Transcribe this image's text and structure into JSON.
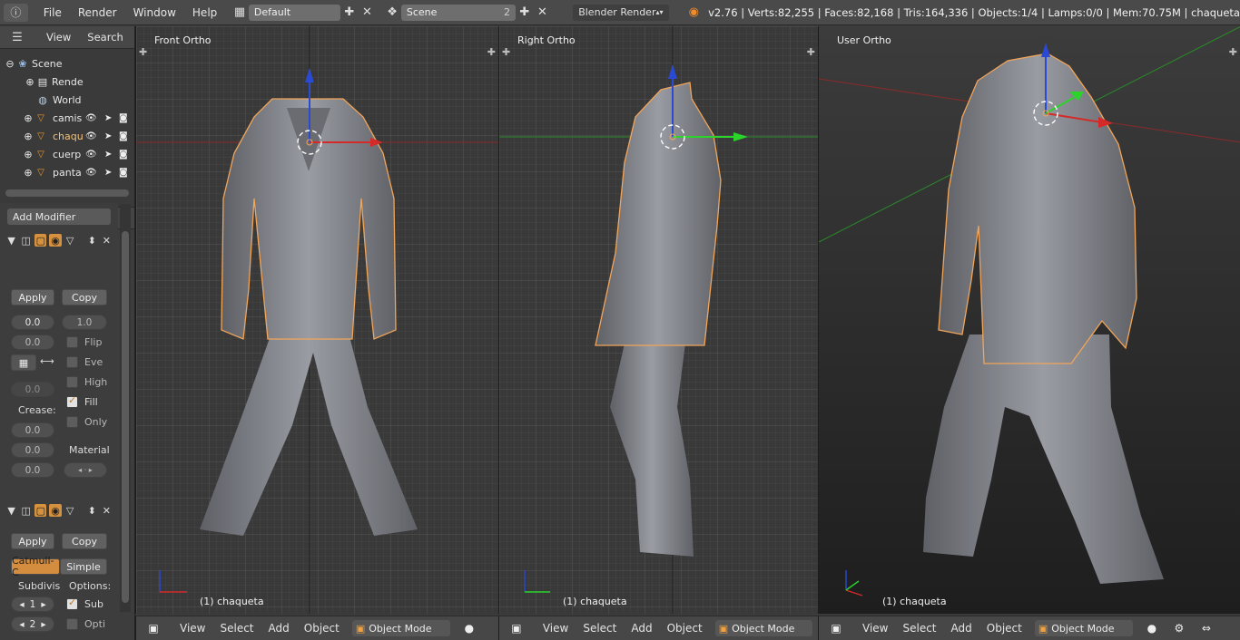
{
  "topbar": {
    "menus": [
      "File",
      "Render",
      "Window",
      "Help"
    ],
    "layout_name": "Default",
    "scene_name": "Scene",
    "scene_users": "2",
    "renderer": "Blender Render",
    "stats": "v2.76 | Verts:82,255 | Faces:82,168 | Tris:164,336 | Objects:1/4 | Lamps:0/0 | Mem:70.75M | chaqueta"
  },
  "outliner": {
    "header_items": [
      "View",
      "Search"
    ],
    "rows": [
      "Scene",
      "Rende",
      "World",
      "camis",
      "chaqu",
      "cuerp",
      "panta"
    ]
  },
  "properties": {
    "add_modifier": "Add Modifier",
    "mirror": {
      "apply": "Apply",
      "copy": "Copy",
      "val_a": "0.0",
      "val_b": "1.0",
      "val_c": "0.0",
      "val_d": "0.0",
      "flip": "Flip",
      "even": "Eve",
      "high": "High",
      "fill": "Fill",
      "only": "Only",
      "crease": "Crease:",
      "crease_1": "0.0",
      "crease_2": "0.0",
      "crease_3": "0.0",
      "material": "Material"
    },
    "subsurf": {
      "apply": "Apply",
      "copy": "Copy",
      "catmull": "Catmull-C",
      "simple": "Simple",
      "subdivis": "Subdivis",
      "options": "Options:",
      "level_1": "1",
      "level_2": "2",
      "sub": "Sub",
      "opti": "Opti"
    }
  },
  "viewports": [
    {
      "title": "Front Ortho",
      "object": "(1) chaqueta"
    },
    {
      "title": "Right Ortho",
      "object": "(1) chaqueta"
    },
    {
      "title": "User Ortho",
      "object": "(1) chaqueta"
    }
  ],
  "viewbar": {
    "view": "View",
    "select": "Select",
    "add": "Add",
    "object": "Object",
    "mode": "Object Mode"
  },
  "colors": {
    "accent": "#d48d3e",
    "selection_outline": "#f0a55a",
    "axis_x": "#d42a2a",
    "axis_y": "#2ad42a",
    "axis_z": "#2a4ad4"
  }
}
